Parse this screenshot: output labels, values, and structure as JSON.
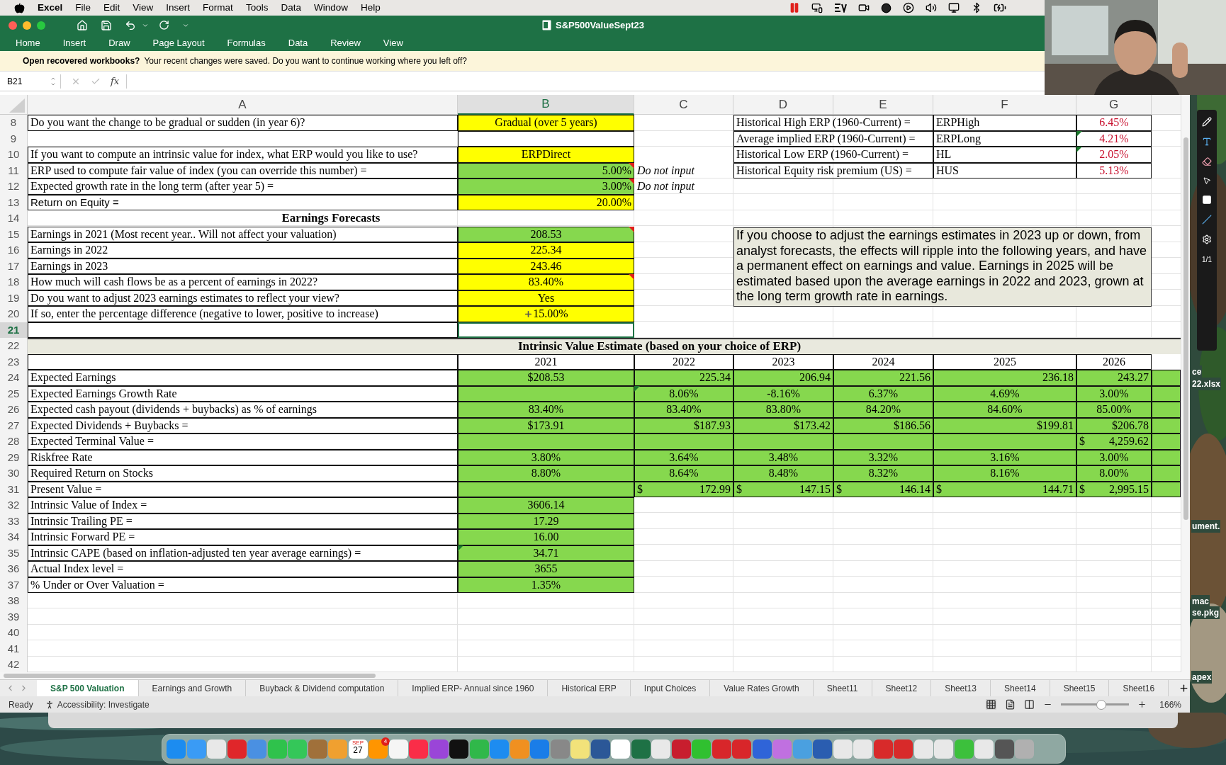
{
  "menu_bar": {
    "app": "Excel",
    "items": [
      "File",
      "Edit",
      "View",
      "Insert",
      "Format",
      "Tools",
      "Data",
      "Window",
      "Help"
    ]
  },
  "window": {
    "title": "S&P500ValueSept23",
    "ribbon_tabs": [
      {
        "label": "Home",
        "selected": false
      },
      {
        "label": "Insert",
        "selected": false
      },
      {
        "label": "Draw",
        "selected": false
      },
      {
        "label": "Page Layout",
        "selected": false
      },
      {
        "label": "Formulas",
        "selected": false
      },
      {
        "label": "Data",
        "selected": false
      },
      {
        "label": "Review",
        "selected": false
      },
      {
        "label": "View",
        "selected": false
      }
    ]
  },
  "notice": {
    "action": "Open recovered workbooks?",
    "message": "Your recent changes were saved. Do you want to continue working where you left off?"
  },
  "formula_bar": {
    "name_box": "B21",
    "fx": "fx"
  },
  "sheet": {
    "columns": [
      {
        "label": "A",
        "selected": false
      },
      {
        "label": "B",
        "selected": true
      },
      {
        "label": "C",
        "selected": false
      },
      {
        "label": "D",
        "selected": false
      },
      {
        "label": "E",
        "selected": false
      },
      {
        "label": "F",
        "selected": false
      },
      {
        "label": "G",
        "selected": false
      }
    ],
    "rows": [
      {
        "n": "8",
        "selected": false,
        "cells": {
          "A": {
            "text": "Do you want the change to be gradual or sudden (in year 6)?"
          },
          "B": {
            "text": "Gradual (over 5 years)",
            "color": "#ffff00",
            "kind": "centered"
          },
          "D": {
            "text": "Historical High ERP (1960-Current) ="
          },
          "E": {
            "merged": true
          },
          "F": {
            "text": "ERPHigh"
          },
          "G": {
            "text": "6.45%",
            "kind": "reference"
          }
        }
      },
      {
        "n": "9",
        "selected": false,
        "cells": {
          "B": {
            "bordered": true
          },
          "D": {
            "text": "Average implied ERP (1960-Current) ="
          },
          "E": {
            "merged": true
          },
          "F": {
            "text": "ERPLong"
          },
          "G": {
            "text": "4.21%",
            "kind": "reference",
            "flag": true
          }
        }
      },
      {
        "n": "10",
        "selected": false,
        "cells": {
          "A": {
            "text": "If you want to compute an intrinsic value for index, what ERP would you like to use?"
          },
          "B": {
            "text": "ERPDirect",
            "color": "#ffff00",
            "kind": "centered"
          },
          "D": {
            "text": "Historical Low ERP (1960-Current) ="
          },
          "E": {
            "merged": true
          },
          "F": {
            "text": "HL"
          },
          "G": {
            "text": "2.05%",
            "kind": "reference",
            "flag": true
          }
        }
      },
      {
        "n": "11",
        "selected": false,
        "cells": {
          "A": {
            "text": "ERP used to compute fair value of index (you can override this number) ="
          },
          "B": {
            "text": "5.00%",
            "color": "#86d84e",
            "kind": "right",
            "comment": true
          },
          "C": {
            "text": "Do not input",
            "kind": "note"
          },
          "D": {
            "text": "Historical Equity risk premium (US) ="
          },
          "E": {
            "merged": true
          },
          "F": {
            "text": "HUS"
          },
          "G": {
            "text": "5.13%",
            "kind": "reference"
          }
        }
      },
      {
        "n": "12",
        "selected": false,
        "cells": {
          "A": {
            "text": "Expected growth rate in the long term (after year 5) ="
          },
          "B": {
            "text": "3.00%",
            "color": "#86d84e",
            "kind": "right",
            "comment": true
          },
          "C": {
            "text": "Do not input",
            "kind": "note"
          }
        }
      },
      {
        "n": "13",
        "selected": false,
        "cells": {
          "A": {
            "text": "Return on Equity =",
            "kind": "sans"
          },
          "B": {
            "text": "20.00%",
            "color": "#ffff00",
            "kind": "right"
          }
        }
      },
      {
        "n": "14",
        "selected": false,
        "cells": {
          "A": {
            "text": "Earnings Forecasts",
            "kind": "heading"
          },
          "B": {
            "merged": true
          }
        }
      },
      {
        "n": "15",
        "selected": false,
        "cells": {
          "A": {
            "text": "Earnings in 2021 (Most recent year.. Will not affect your valuation)"
          },
          "B": {
            "text": "208.53",
            "color": "#86d84e",
            "kind": "centered",
            "comment": true
          }
        }
      },
      {
        "n": "16",
        "selected": false,
        "cells": {
          "A": {
            "text": "Earnings in 2022"
          },
          "B": {
            "text": "225.34",
            "color": "#ffff00",
            "kind": "centered"
          }
        }
      },
      {
        "n": "17",
        "selected": false,
        "cells": {
          "A": {
            "text": "Earnings in 2023"
          },
          "B": {
            "text": "243.46",
            "color": "#ffff00",
            "kind": "centered"
          }
        }
      },
      {
        "n": "18",
        "selected": false,
        "cells": {
          "A": {
            "text": "How much will cash flows be as a percent of earnings in 2022?"
          },
          "B": {
            "text": "83.40%",
            "color": "#ffff00",
            "kind": "centered",
            "comment": true
          }
        }
      },
      {
        "n": "19",
        "selected": false,
        "cells": {
          "A": {
            "text": "Do you want to adjust 2023 earnings estimates to reflect your view?"
          },
          "B": {
            "text": "Yes",
            "color": "#ffff00",
            "kind": "centered"
          }
        }
      },
      {
        "n": "20",
        "selected": false,
        "cells": {
          "A": {
            "text": "If so, enter the percentage difference (negative to lower, positive to increase)"
          },
          "B": {
            "text": "15.00%",
            "color": "#ffff00",
            "kind": "centered",
            "cursor": true
          }
        }
      },
      {
        "n": "21",
        "selected": true,
        "cells": {
          "A": {
            "bordered": true
          }
        }
      },
      {
        "n": "22",
        "selected": false,
        "cells": {
          "A": {
            "text": "Intrinsic Value Estimate (based on your choice of ERP)",
            "kind": "banner",
            "color": "#e9e9de"
          }
        }
      },
      {
        "n": "23",
        "selected": false,
        "cells": {
          "A": {
            "bordered": true
          },
          "B": {
            "text": "2021",
            "kind": "centered"
          },
          "C": {
            "text": "2022",
            "kind": "centered"
          },
          "D": {
            "text": "2023",
            "kind": "centered"
          },
          "E": {
            "text": "2024",
            "kind": "centered"
          },
          "F": {
            "text": "2025",
            "kind": "centered"
          },
          "G": {
            "text": "2026",
            "kind": "centered"
          }
        }
      },
      {
        "n": "24",
        "selected": false,
        "cells": {
          "A": {
            "text": "Expected Earnings"
          },
          "B": {
            "text": "$208.53",
            "color": "#86d84e",
            "kind": "centered"
          },
          "C": {
            "text": "225.34",
            "color": "#86d84e",
            "kind": "right"
          },
          "D": {
            "text": "206.94",
            "color": "#86d84e",
            "kind": "right"
          },
          "E": {
            "text": "221.56",
            "color": "#86d84e",
            "kind": "right"
          },
          "F": {
            "text": "236.18",
            "color": "#86d84e",
            "kind": "right"
          },
          "G": {
            "text": "243.27",
            "color": "#86d84e",
            "kind": "right"
          },
          "H": {
            "color": "#86d84e"
          }
        }
      },
      {
        "n": "25",
        "selected": false,
        "cells": {
          "A": {
            "text": "Expected Earnings Growth Rate"
          },
          "B": {
            "color": "#86d84e"
          },
          "C": {
            "text": "8.06%",
            "color": "#86d84e",
            "kind": "centered",
            "flag": true
          },
          "D": {
            "text": "-8.16%",
            "color": "#86d84e",
            "kind": "centered"
          },
          "E": {
            "text": "6.37%",
            "color": "#86d84e",
            "kind": "centered"
          },
          "F": {
            "text": "4.69%",
            "color": "#86d84e",
            "kind": "centered"
          },
          "G": {
            "text": "3.00%",
            "color": "#86d84e",
            "kind": "centered"
          },
          "H": {
            "color": "#86d84e"
          }
        }
      },
      {
        "n": "26",
        "selected": false,
        "cells": {
          "A": {
            "text": "Expected cash payout (dividends + buybacks) as % of earnings"
          },
          "B": {
            "text": "83.40%",
            "color": "#86d84e",
            "kind": "centered"
          },
          "C": {
            "text": "83.40%",
            "color": "#86d84e",
            "kind": "centered"
          },
          "D": {
            "text": "83.80%",
            "color": "#86d84e",
            "kind": "centered"
          },
          "E": {
            "text": "84.20%",
            "color": "#86d84e",
            "kind": "centered"
          },
          "F": {
            "text": "84.60%",
            "color": "#86d84e",
            "kind": "centered"
          },
          "G": {
            "text": "85.00%",
            "color": "#86d84e",
            "kind": "centered"
          },
          "H": {
            "color": "#86d84e"
          }
        }
      },
      {
        "n": "27",
        "selected": false,
        "cells": {
          "A": {
            "text": "Expected Dividends + Buybacks ="
          },
          "B": {
            "text": "$173.91",
            "color": "#86d84e",
            "kind": "centered"
          },
          "C": {
            "text": "$187.93",
            "color": "#86d84e",
            "kind": "right"
          },
          "D": {
            "text": "$173.42",
            "color": "#86d84e",
            "kind": "right"
          },
          "E": {
            "text": "$186.56",
            "color": "#86d84e",
            "kind": "right"
          },
          "F": {
            "text": "$199.81",
            "color": "#86d84e",
            "kind": "right"
          },
          "G": {
            "text": "$206.78",
            "color": "#86d84e",
            "kind": "right"
          },
          "H": {
            "color": "#86d84e"
          }
        }
      },
      {
        "n": "28",
        "selected": false,
        "cells": {
          "A": {
            "text": "Expected Terminal Value ="
          },
          "B": {
            "color": "#86d84e"
          },
          "C": {
            "color": "#86d84e"
          },
          "D": {
            "color": "#86d84e"
          },
          "E": {
            "color": "#86d84e"
          },
          "F": {
            "color": "#86d84e"
          },
          "G": {
            "text": "4,259.62",
            "currency": "$",
            "color": "#86d84e"
          },
          "H": {
            "color": "#86d84e"
          }
        }
      },
      {
        "n": "29",
        "selected": false,
        "cells": {
          "A": {
            "text": "Riskfree Rate"
          },
          "B": {
            "text": "3.80%",
            "color": "#86d84e",
            "kind": "centered"
          },
          "C": {
            "text": "3.64%",
            "color": "#86d84e",
            "kind": "centered"
          },
          "D": {
            "text": "3.48%",
            "color": "#86d84e",
            "kind": "centered"
          },
          "E": {
            "text": "3.32%",
            "color": "#86d84e",
            "kind": "centered"
          },
          "F": {
            "text": "3.16%",
            "color": "#86d84e",
            "kind": "centered"
          },
          "G": {
            "text": "3.00%",
            "color": "#86d84e",
            "kind": "centered"
          },
          "H": {
            "color": "#86d84e"
          }
        }
      },
      {
        "n": "30",
        "selected": false,
        "cells": {
          "A": {
            "text": "Required Return on Stocks"
          },
          "B": {
            "text": "8.80%",
            "color": "#86d84e",
            "kind": "centered"
          },
          "C": {
            "text": "8.64%",
            "color": "#86d84e",
            "kind": "centered"
          },
          "D": {
            "text": "8.48%",
            "color": "#86d84e",
            "kind": "centered"
          },
          "E": {
            "text": "8.32%",
            "color": "#86d84e",
            "kind": "centered"
          },
          "F": {
            "text": "8.16%",
            "color": "#86d84e",
            "kind": "centered"
          },
          "G": {
            "text": "8.00%",
            "color": "#86d84e",
            "kind": "centered"
          },
          "H": {
            "color": "#86d84e"
          }
        }
      },
      {
        "n": "31",
        "selected": false,
        "cells": {
          "A": {
            "text": "Present Value ="
          },
          "B": {
            "color": "#86d84e"
          },
          "C": {
            "text": "172.99",
            "currency": "$",
            "color": "#86d84e"
          },
          "D": {
            "text": "147.15",
            "currency": "$",
            "color": "#86d84e"
          },
          "E": {
            "text": "146.14",
            "currency": "$",
            "color": "#86d84e"
          },
          "F": {
            "text": "144.71",
            "currency": "$",
            "color": "#86d84e"
          },
          "G": {
            "text": "2,995.15",
            "currency": "$",
            "color": "#86d84e"
          },
          "H": {
            "color": "#86d84e"
          }
        }
      },
      {
        "n": "32",
        "selected": false,
        "cells": {
          "A": {
            "text": "Intrinsic Value of Index ="
          },
          "B": {
            "text": "3606.14",
            "color": "#86d84e",
            "kind": "centered"
          }
        }
      },
      {
        "n": "33",
        "selected": false,
        "cells": {
          "A": {
            "text": "Intrinsic Trailing PE ="
          },
          "B": {
            "text": "17.29",
            "color": "#86d84e",
            "kind": "centered"
          }
        }
      },
      {
        "n": "34",
        "selected": false,
        "cells": {
          "A": {
            "text": "Intrinsic Forward PE ="
          },
          "B": {
            "text": "16.00",
            "color": "#86d84e",
            "kind": "centered"
          }
        }
      },
      {
        "n": "35",
        "selected": false,
        "cells": {
          "A": {
            "text": "Intrinsic CAPE (based on inflation-adjusted ten year average earnings) ="
          },
          "B": {
            "text": "34.71",
            "color": "#86d84e",
            "kind": "centered",
            "flag": true
          }
        }
      },
      {
        "n": "36",
        "selected": false,
        "cells": {
          "A": {
            "text": "Actual Index level ="
          },
          "B": {
            "text": "3655",
            "color": "#86d84e",
            "kind": "centered"
          }
        }
      },
      {
        "n": "37",
        "selected": false,
        "cells": {
          "A": {
            "text": "% Under or Over Valuation ="
          },
          "B": {
            "text": "1.35%",
            "color": "#86d84e",
            "kind": "centered"
          }
        }
      },
      {
        "n": "38",
        "selected": false
      },
      {
        "n": "39",
        "selected": false
      },
      {
        "n": "40",
        "selected": false
      },
      {
        "n": "41",
        "selected": false
      },
      {
        "n": "42",
        "selected": false
      }
    ]
  },
  "text_box": "If you choose to adjust the earnings estimates in 2023 up or down, from analyst forecasts, the effects will ripple into the following years, and have a permanent effect on earnings and value. Earnings in 2025 will be estimated based upon the average earnings in 2022 and 2023, grown at the long term growth rate in earnings.",
  "sheet_tabs": [
    {
      "label": "S&P 500 Valuation",
      "selected": true
    },
    {
      "label": "Earnings and Growth",
      "selected": false
    },
    {
      "label": "Buyback & Dividend computation",
      "selected": false
    },
    {
      "label": "Implied ERP- Annual since 1960",
      "selected": false
    },
    {
      "label": "Historical ERP",
      "selected": false
    },
    {
      "label": "Input Choices",
      "selected": false
    },
    {
      "label": "Value Rates Growth",
      "selected": false
    },
    {
      "label": "Sheet11",
      "selected": false
    },
    {
      "label": "Sheet12",
      "selected": false
    },
    {
      "label": "Sheet13",
      "selected": false
    },
    {
      "label": "Sheet14",
      "selected": false
    },
    {
      "label": "Sheet15",
      "selected": false
    },
    {
      "label": "Sheet16",
      "selected": false
    }
  ],
  "status_bar": {
    "mode": "Ready",
    "accessibility": "Accessibility: Investigate",
    "zoom": {
      "level": 0.59
    },
    "zoom_reading": "166%"
  },
  "annotation_toolbar": {
    "page": "1/1"
  },
  "desktop_labels": [
    "ce",
    "22.xlsx",
    "ument.",
    "mac",
    "se.pkg",
    "apex"
  ],
  "dock": {
    "calendar_month": "SEP",
    "calendar_day": "27",
    "reminders_badge": "4"
  }
}
